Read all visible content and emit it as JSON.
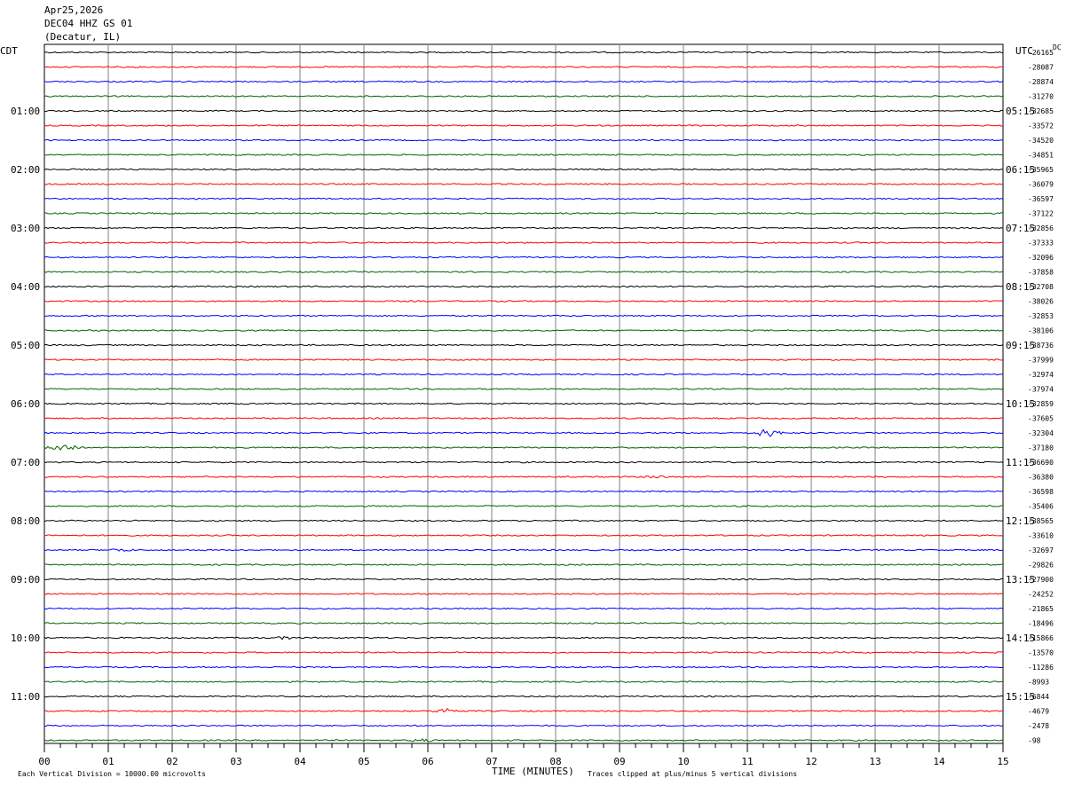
{
  "header": {
    "date": "Apr25,2026",
    "station": "DEC04 HHZ GS 01",
    "location": "(Decatur, IL)"
  },
  "left_tz": "CDT",
  "right_tz": "UTC",
  "dc_label": "DC",
  "footer": {
    "vertical_division": "Each Vertical Division = 10000.00 microvolts",
    "xlabel": "TIME (MINUTES)",
    "clip_note": "Traces clipped at plus/minus 5 vertical divisions"
  },
  "colors": {
    "trace_cycle": [
      "#000000",
      "#ff0000",
      "#0000ff",
      "#006400"
    ],
    "grid": "#808080",
    "frame": "#000000"
  },
  "chart_data": {
    "type": "line",
    "title": "DEC04 HHZ GS 01",
    "subtitle": "(Decatur, IL)",
    "xlabel": "TIME (MINUTES)",
    "ylabel": "",
    "xlim": [
      0,
      15
    ],
    "x_ticks": [
      "00",
      "01",
      "02",
      "03",
      "04",
      "05",
      "06",
      "07",
      "08",
      "09",
      "10",
      "11",
      "12",
      "13",
      "14",
      "15"
    ],
    "grid": true,
    "rows": 48,
    "left_hour_labels": [
      "01:00",
      "02:00",
      "03:00",
      "04:00",
      "05:00",
      "06:00",
      "07:00",
      "08:00",
      "09:00",
      "10:00",
      "11:00"
    ],
    "right_hour_labels": [
      "05:15",
      "06:15",
      "07:15",
      "08:15",
      "09:15",
      "10:15",
      "11:15",
      "12:15",
      "13:15",
      "14:15",
      "15:15"
    ],
    "dc_values": [
      "-26165",
      "-28087",
      "-28874",
      "-31270",
      "-32685",
      "-33572",
      "-34520",
      "-34851",
      "-35965",
      "-36079",
      "-36597",
      "-37122",
      "-32856",
      "-37333",
      "-32096",
      "-37858",
      "-32708",
      "-38026",
      "-32853",
      "-38106",
      "-38736",
      "-37999",
      "-32974",
      "-37974",
      "-32859",
      "-37605",
      "-32304",
      "-37180",
      "-36690",
      "-36380",
      "-36598",
      "-35406",
      "-38565",
      "-33610",
      "-32697",
      "-29826",
      "-27900",
      "-24252",
      "-21865",
      "-18496",
      "-15866",
      "-13570",
      "-11286",
      "-8993",
      "-6844",
      "-4679",
      "-2478",
      "-98"
    ],
    "events": [
      {
        "row": 26,
        "minute": 11.3,
        "amplitude": "large"
      },
      {
        "row": 27,
        "minute": 0.3,
        "amplitude": "large"
      },
      {
        "row": 45,
        "minute": 6.3,
        "amplitude": "medium"
      },
      {
        "row": 40,
        "minute": 3.8,
        "amplitude": "small"
      },
      {
        "row": 29,
        "minute": 9.6,
        "amplitude": "small"
      },
      {
        "row": 34,
        "minute": 1.2,
        "amplitude": "small"
      },
      {
        "row": 47,
        "minute": 5.9,
        "amplitude": "small"
      }
    ]
  }
}
